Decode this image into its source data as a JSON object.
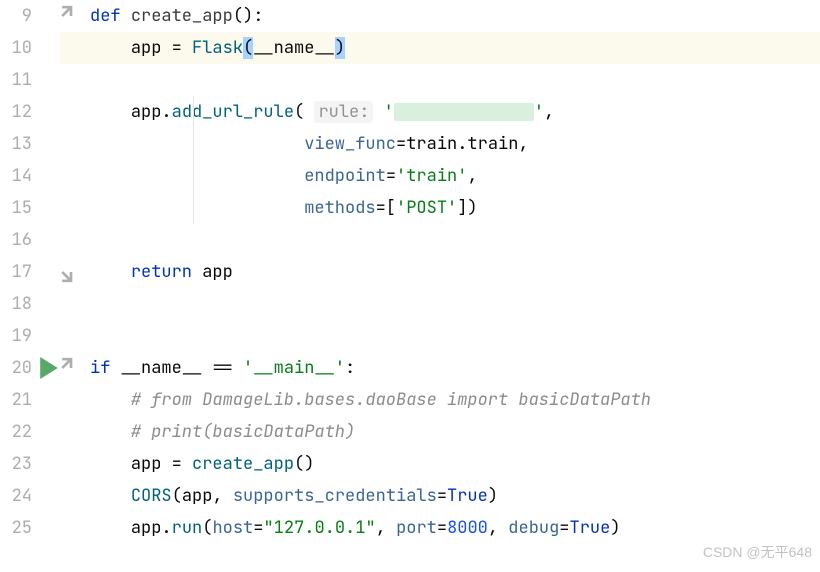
{
  "gutter": {
    "start": 9,
    "end": 25,
    "highlighted": 10,
    "run_marker": 20
  },
  "lines": {
    "l9": {
      "indent": "",
      "kw": "def ",
      "fn": "create_app",
      "rest": "():"
    },
    "l10": {
      "indent": "    ",
      "lhs": "app ",
      "eq": "= ",
      "call": "Flask",
      "open": "(",
      "arg": "__name__",
      "close": ")"
    },
    "l11": {
      "blank": ""
    },
    "l12": {
      "indent": "    ",
      "obj": "app.",
      "method": "add_url_rule",
      "open": "(",
      "hint": "rule:",
      "space": " ",
      "str1": "'",
      "str2": "'",
      "comma": ","
    },
    "l13": {
      "indent": "                     ",
      "param": "view_func",
      "eq": "=",
      "val": "train.train",
      "comma": ","
    },
    "l14": {
      "indent": "                     ",
      "param": "endpoint",
      "eq": "=",
      "str": "'train'",
      "comma": ","
    },
    "l15": {
      "indent": "                     ",
      "param": "methods",
      "eq": "=[",
      "str": "'POST'",
      "close": "])"
    },
    "l16": {
      "blank": ""
    },
    "l17": {
      "indent": "    ",
      "kw": "return ",
      "var": "app"
    },
    "l18": {
      "blank": ""
    },
    "l19": {
      "blank": ""
    },
    "l20": {
      "kw": "if ",
      "name": "__name__ ",
      "op": "== ",
      "str": "'__main__'",
      "colon": ":"
    },
    "l21": {
      "indent": "    ",
      "cmt": "# from DamageLib.bases.daoBase import basicDataPath"
    },
    "l22": {
      "indent": "    ",
      "cmt": "# print(basicDataPath)"
    },
    "l23": {
      "indent": "    ",
      "lhs": "app ",
      "eq": "= ",
      "fn": "create_app",
      "rest": "()"
    },
    "l24": {
      "indent": "    ",
      "fn": "CORS",
      "open": "(app, ",
      "param": "supports_credentials",
      "eq": "=",
      "kw": "True",
      "close": ")"
    },
    "l25": {
      "indent": "    ",
      "obj": "app.",
      "method": "run",
      "open": "(",
      "p1": "host",
      "eq1": "=",
      "s1": "\"127.0.0.1\"",
      "c1": ", ",
      "p2": "port",
      "eq2": "=",
      "n2": "8000",
      "c2": ", ",
      "p3": "debug",
      "eq3": "=",
      "k3": "True",
      "close": ")"
    }
  },
  "watermark": "CSDN @无平648"
}
